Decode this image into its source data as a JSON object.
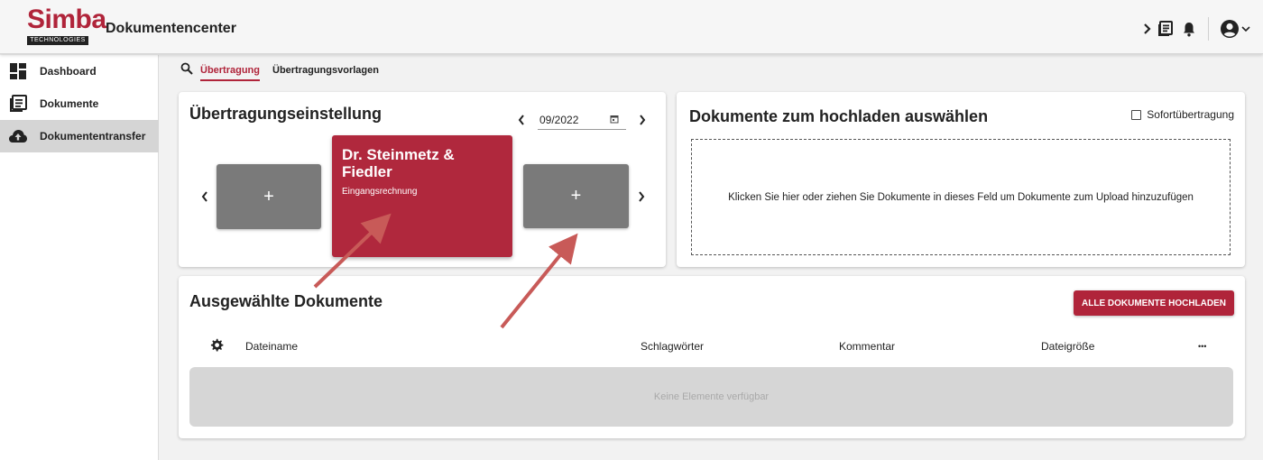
{
  "header": {
    "logo_text": "Simba",
    "logo_tag": "TECHNOLOGIES",
    "title": "Dokumentencenter",
    "icons": [
      "chevron-right-icon",
      "document-list-icon",
      "bell-icon",
      "account-circle-icon",
      "chevron-down-icon"
    ]
  },
  "sidebar": {
    "items": [
      {
        "label": "Dashboard",
        "icon": "dashboard-icon",
        "active": false
      },
      {
        "label": "Dokumente",
        "icon": "document-icon",
        "active": false
      },
      {
        "label": "Dokumententransfer",
        "icon": "cloud-upload-icon",
        "active": true
      }
    ]
  },
  "tabs": {
    "items": [
      {
        "label": "Übertragung",
        "active": true
      },
      {
        "label": "Übertragungsvorlagen",
        "active": false
      }
    ]
  },
  "settings": {
    "title": "Übertragungseinstellung",
    "date_value": "09/2022",
    "tile_add_label": "+",
    "main_tile": {
      "name": "Dr. Steinmetz & Fiedler",
      "subtitle": "Eingangsrechnung"
    }
  },
  "upload": {
    "title": "Dokumente zum hochladen auswählen",
    "instant_label": "Sofortübertragung",
    "instant_checked": false,
    "dropzone_text": "Klicken Sie hier oder ziehen Sie Dokumente in dieses Feld um Dokumente zum Upload hinzuzufügen"
  },
  "selected": {
    "title": "Ausgewählte Dokumente",
    "upload_all_label": "ALLE DOKUMENTE HOCHLADEN",
    "columns": {
      "filename": "Dateiname",
      "tags": "Schlagwörter",
      "comment": "Kommentar",
      "size": "Dateigröße",
      "more": "•••"
    },
    "empty_text": "Keine Elemente verfügbar"
  },
  "colors": {
    "accent": "#b0243a",
    "tile_active": "#b0283d",
    "tile_gray": "#7a7a7a",
    "annotation_arrow": "#c85a58"
  }
}
